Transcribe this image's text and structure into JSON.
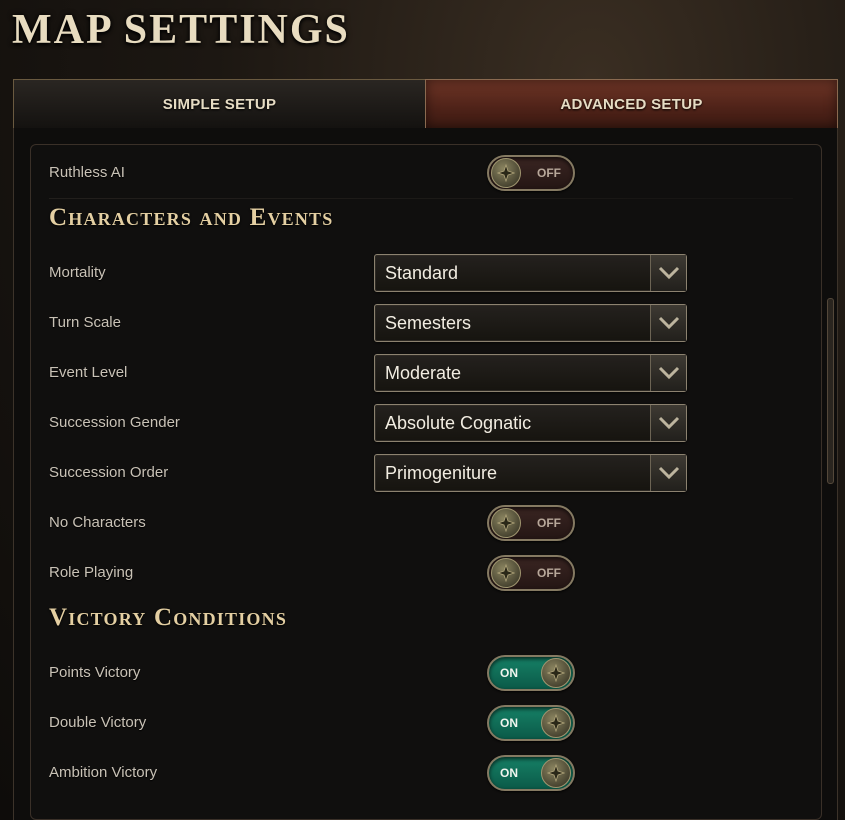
{
  "title": "MAP SETTINGS",
  "tabs": {
    "simple": "SIMPLE SETUP",
    "advanced": "ADVANCED SETUP",
    "active": "advanced"
  },
  "settings": {
    "ruthless_ai": {
      "label": "Ruthless AI",
      "state": "OFF"
    }
  },
  "characters_and_events": {
    "heading": "Characters and Events",
    "mortality": {
      "label": "Mortality",
      "value": "Standard"
    },
    "turn_scale": {
      "label": "Turn Scale",
      "value": "Semesters"
    },
    "event_level": {
      "label": "Event Level",
      "value": "Moderate"
    },
    "succession_gender": {
      "label": "Succession Gender",
      "value": "Absolute Cognatic"
    },
    "succession_order": {
      "label": "Succession Order",
      "value": "Primogeniture"
    },
    "no_characters": {
      "label": "No Characters",
      "state": "OFF"
    },
    "role_playing": {
      "label": "Role Playing",
      "state": "OFF"
    }
  },
  "victory_conditions": {
    "heading": "Victory Conditions",
    "points_victory": {
      "label": "Points Victory",
      "state": "ON"
    },
    "double_victory": {
      "label": "Double Victory",
      "state": "ON"
    },
    "ambition_victory": {
      "label": "Ambition Victory",
      "state": "ON"
    }
  },
  "colors": {
    "toggle_on": "#168066",
    "toggle_off": "#3a2522",
    "heading_gold": "#e4cfa2",
    "active_tab": "#6e3526"
  }
}
